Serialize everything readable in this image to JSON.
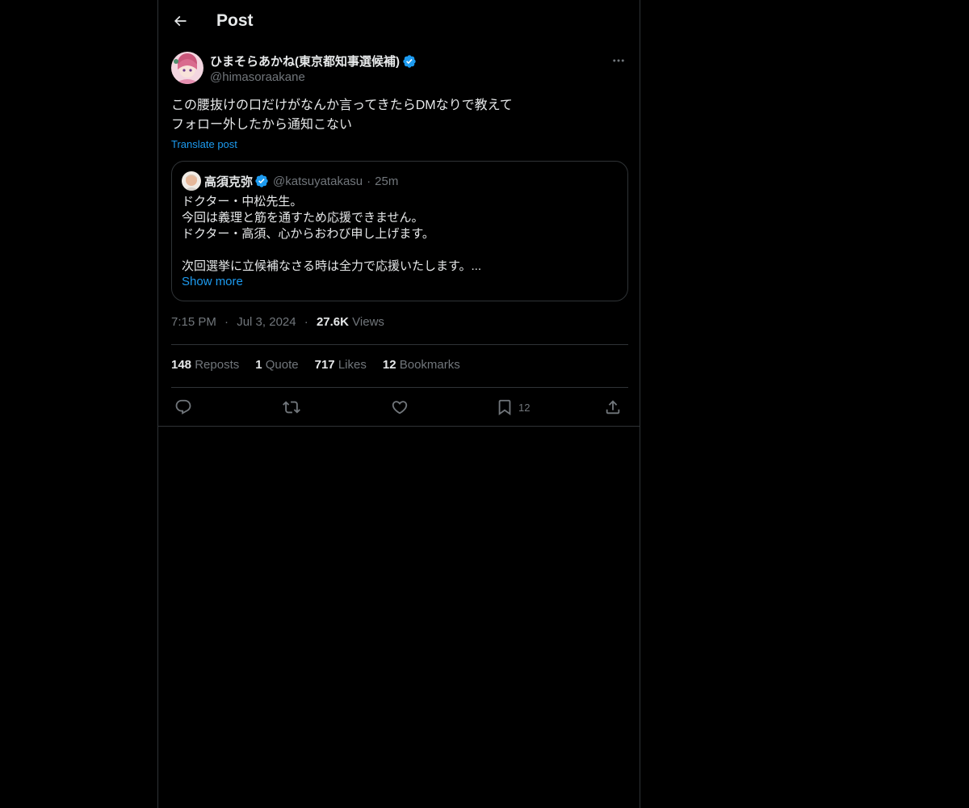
{
  "header": {
    "title": "Post"
  },
  "author": {
    "display_name": "ひまそらあかね(東京都知事選候補)",
    "handle": "@himasoraakane",
    "verified": true
  },
  "post": {
    "lines": [
      "この腰抜けの口だけがなんか言ってきたらDMなりで教えて",
      "フォロー外したから通知こない"
    ],
    "translate_label": "Translate post"
  },
  "quote": {
    "display_name": "高須克弥",
    "handle": "@katsuyatakasu",
    "separator": "·",
    "time": "25m",
    "lines": [
      "ドクター・中松先生。",
      "今回は義理と筋を通すため応援できません。",
      "ドクター・高須、心からおわび申し上げます。",
      "",
      "次回選挙に立候補なさる時は全力で応援いたします。..."
    ],
    "show_more_label": "Show more"
  },
  "meta": {
    "time": "7:15 PM",
    "separator": "·",
    "date": "Jul 3, 2024",
    "views_count": "27.6K",
    "views_label": "Views"
  },
  "stats": {
    "reposts_count": "148",
    "reposts_label": "Reposts",
    "quotes_count": "1",
    "quotes_label": "Quote",
    "likes_count": "717",
    "likes_label": "Likes",
    "bookmarks_count": "12",
    "bookmarks_label": "Bookmarks"
  },
  "actions": {
    "bookmark_count": "12"
  },
  "icons": {
    "back": "arrow-left-icon",
    "more": "more-horizontal-icon",
    "verified": "verified-badge-icon",
    "reply": "reply-icon",
    "repost": "repost-icon",
    "like": "heart-icon",
    "bookmark": "bookmark-icon",
    "share": "share-icon"
  },
  "colors": {
    "background": "#000000",
    "text": "#e7e9ea",
    "muted": "#71767b",
    "accent": "#1d9bf0",
    "border": "#2f3336"
  }
}
